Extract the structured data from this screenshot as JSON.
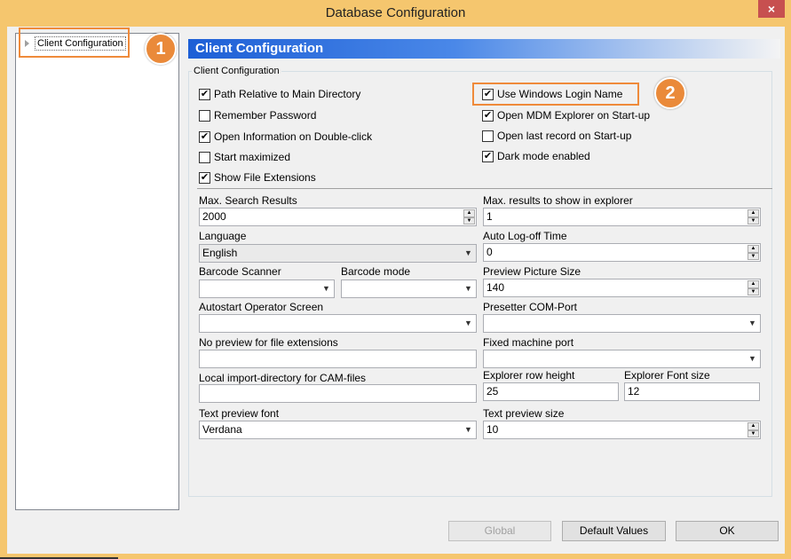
{
  "window": {
    "title": "Database Configuration",
    "close_symbol": "×"
  },
  "tree": {
    "item": "Client Configuration"
  },
  "badges": {
    "one": "1",
    "two": "2"
  },
  "header": {
    "title": "Client Configuration"
  },
  "group": {
    "legend": "Client Configuration"
  },
  "checkboxes": {
    "left": [
      {
        "label": "Path Relative to Main Directory",
        "checked": "✔"
      },
      {
        "label": "Remember Password",
        "checked": ""
      },
      {
        "label": "Open Information on Double-click",
        "checked": "✔"
      },
      {
        "label": "Start maximized",
        "checked": ""
      },
      {
        "label": "Show File Extensions",
        "checked": "✔"
      }
    ],
    "right": [
      {
        "label": "Use Windows Login Name",
        "checked": "✔"
      },
      {
        "label": "Open MDM Explorer on Start-up",
        "checked": "✔"
      },
      {
        "label": "Open last record on Start-up",
        "checked": ""
      },
      {
        "label": "Dark mode enabled",
        "checked": "✔"
      }
    ]
  },
  "fields": {
    "max_search_results": {
      "label": "Max. Search Results",
      "value": "2000"
    },
    "max_results_explorer": {
      "label": "Max. results to show in explorer",
      "value": "1"
    },
    "language": {
      "label": "Language",
      "value": "English"
    },
    "auto_logoff": {
      "label": "Auto Log-off Time",
      "value": "0"
    },
    "barcode_scanner": {
      "label": "Barcode Scanner",
      "value": ""
    },
    "barcode_mode": {
      "label": "Barcode mode",
      "value": ""
    },
    "preview_picture_size": {
      "label": "Preview Picture Size",
      "value": "140"
    },
    "autostart_operator": {
      "label": "Autostart Operator Screen",
      "value": ""
    },
    "presetter_com": {
      "label": "Presetter COM-Port",
      "value": ""
    },
    "no_preview_ext": {
      "label": "No preview for file extensions",
      "value": ""
    },
    "fixed_machine_port": {
      "label": "Fixed machine port",
      "value": ""
    },
    "local_import_dir": {
      "label": "Local import-directory for CAM-files",
      "value": ""
    },
    "explorer_row_height": {
      "label": "Explorer row height",
      "value": "25"
    },
    "explorer_font_size": {
      "label": "Explorer Font size",
      "value": "12"
    },
    "text_preview_font": {
      "label": "Text preview font",
      "value": "Verdana"
    },
    "text_preview_size": {
      "label": "Text preview size",
      "value": "10"
    }
  },
  "buttons": {
    "global": "Global",
    "default_values": "Default Values",
    "ok": "OK"
  },
  "symbols": {
    "up": "▲",
    "down": "▼",
    "dropdown": "▼"
  }
}
